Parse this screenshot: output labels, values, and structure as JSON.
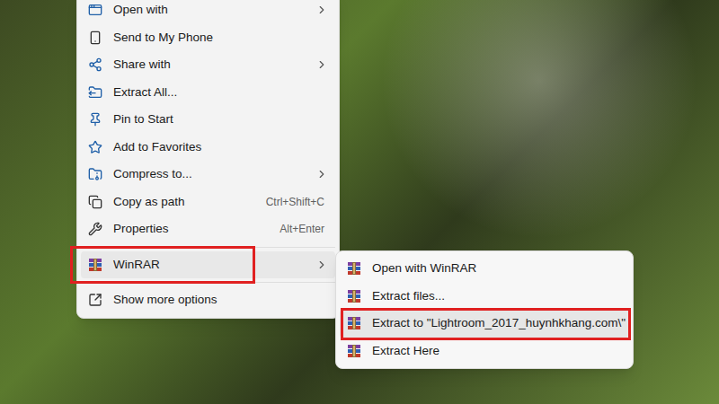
{
  "desktop": {
    "wallpaper": "photo"
  },
  "context_menu": {
    "items": [
      {
        "kind": "item",
        "label": "Open with",
        "shortcut": "",
        "submenu": true,
        "highlighted": false,
        "annotated": false
      },
      {
        "kind": "item",
        "label": "Send to My Phone",
        "shortcut": "",
        "submenu": false,
        "highlighted": false,
        "annotated": false
      },
      {
        "kind": "item",
        "label": "Share with",
        "shortcut": "",
        "submenu": true,
        "highlighted": false,
        "annotated": false
      },
      {
        "kind": "item",
        "label": "Extract All...",
        "shortcut": "",
        "submenu": false,
        "highlighted": false,
        "annotated": false
      },
      {
        "kind": "item",
        "label": "Pin to Start",
        "shortcut": "",
        "submenu": false,
        "highlighted": false,
        "annotated": false
      },
      {
        "kind": "item",
        "label": "Add to Favorites",
        "shortcut": "",
        "submenu": false,
        "highlighted": false,
        "annotated": false
      },
      {
        "kind": "item",
        "label": "Compress to...",
        "shortcut": "",
        "submenu": true,
        "highlighted": false,
        "annotated": false
      },
      {
        "kind": "item",
        "label": "Copy as path",
        "shortcut": "Ctrl+Shift+C",
        "submenu": false,
        "highlighted": false,
        "annotated": false
      },
      {
        "kind": "item",
        "label": "Properties",
        "shortcut": "Alt+Enter",
        "submenu": false,
        "highlighted": false,
        "annotated": false
      },
      {
        "kind": "separator"
      },
      {
        "kind": "item",
        "label": "WinRAR",
        "shortcut": "",
        "submenu": true,
        "highlighted": true,
        "annotated": true
      },
      {
        "kind": "separator"
      },
      {
        "kind": "item",
        "label": "Show more options",
        "shortcut": "",
        "submenu": false,
        "highlighted": false,
        "annotated": false
      }
    ]
  },
  "submenu": {
    "items": [
      {
        "label": "Open with WinRAR",
        "highlighted": false,
        "annotated": false
      },
      {
        "label": "Extract files...",
        "highlighted": false,
        "annotated": false
      },
      {
        "label": "Extract to \"Lightroom_2017_huynhkhang.com\\\"",
        "highlighted": true,
        "annotated": true
      },
      {
        "label": "Extract Here",
        "highlighted": false,
        "annotated": false
      }
    ]
  }
}
